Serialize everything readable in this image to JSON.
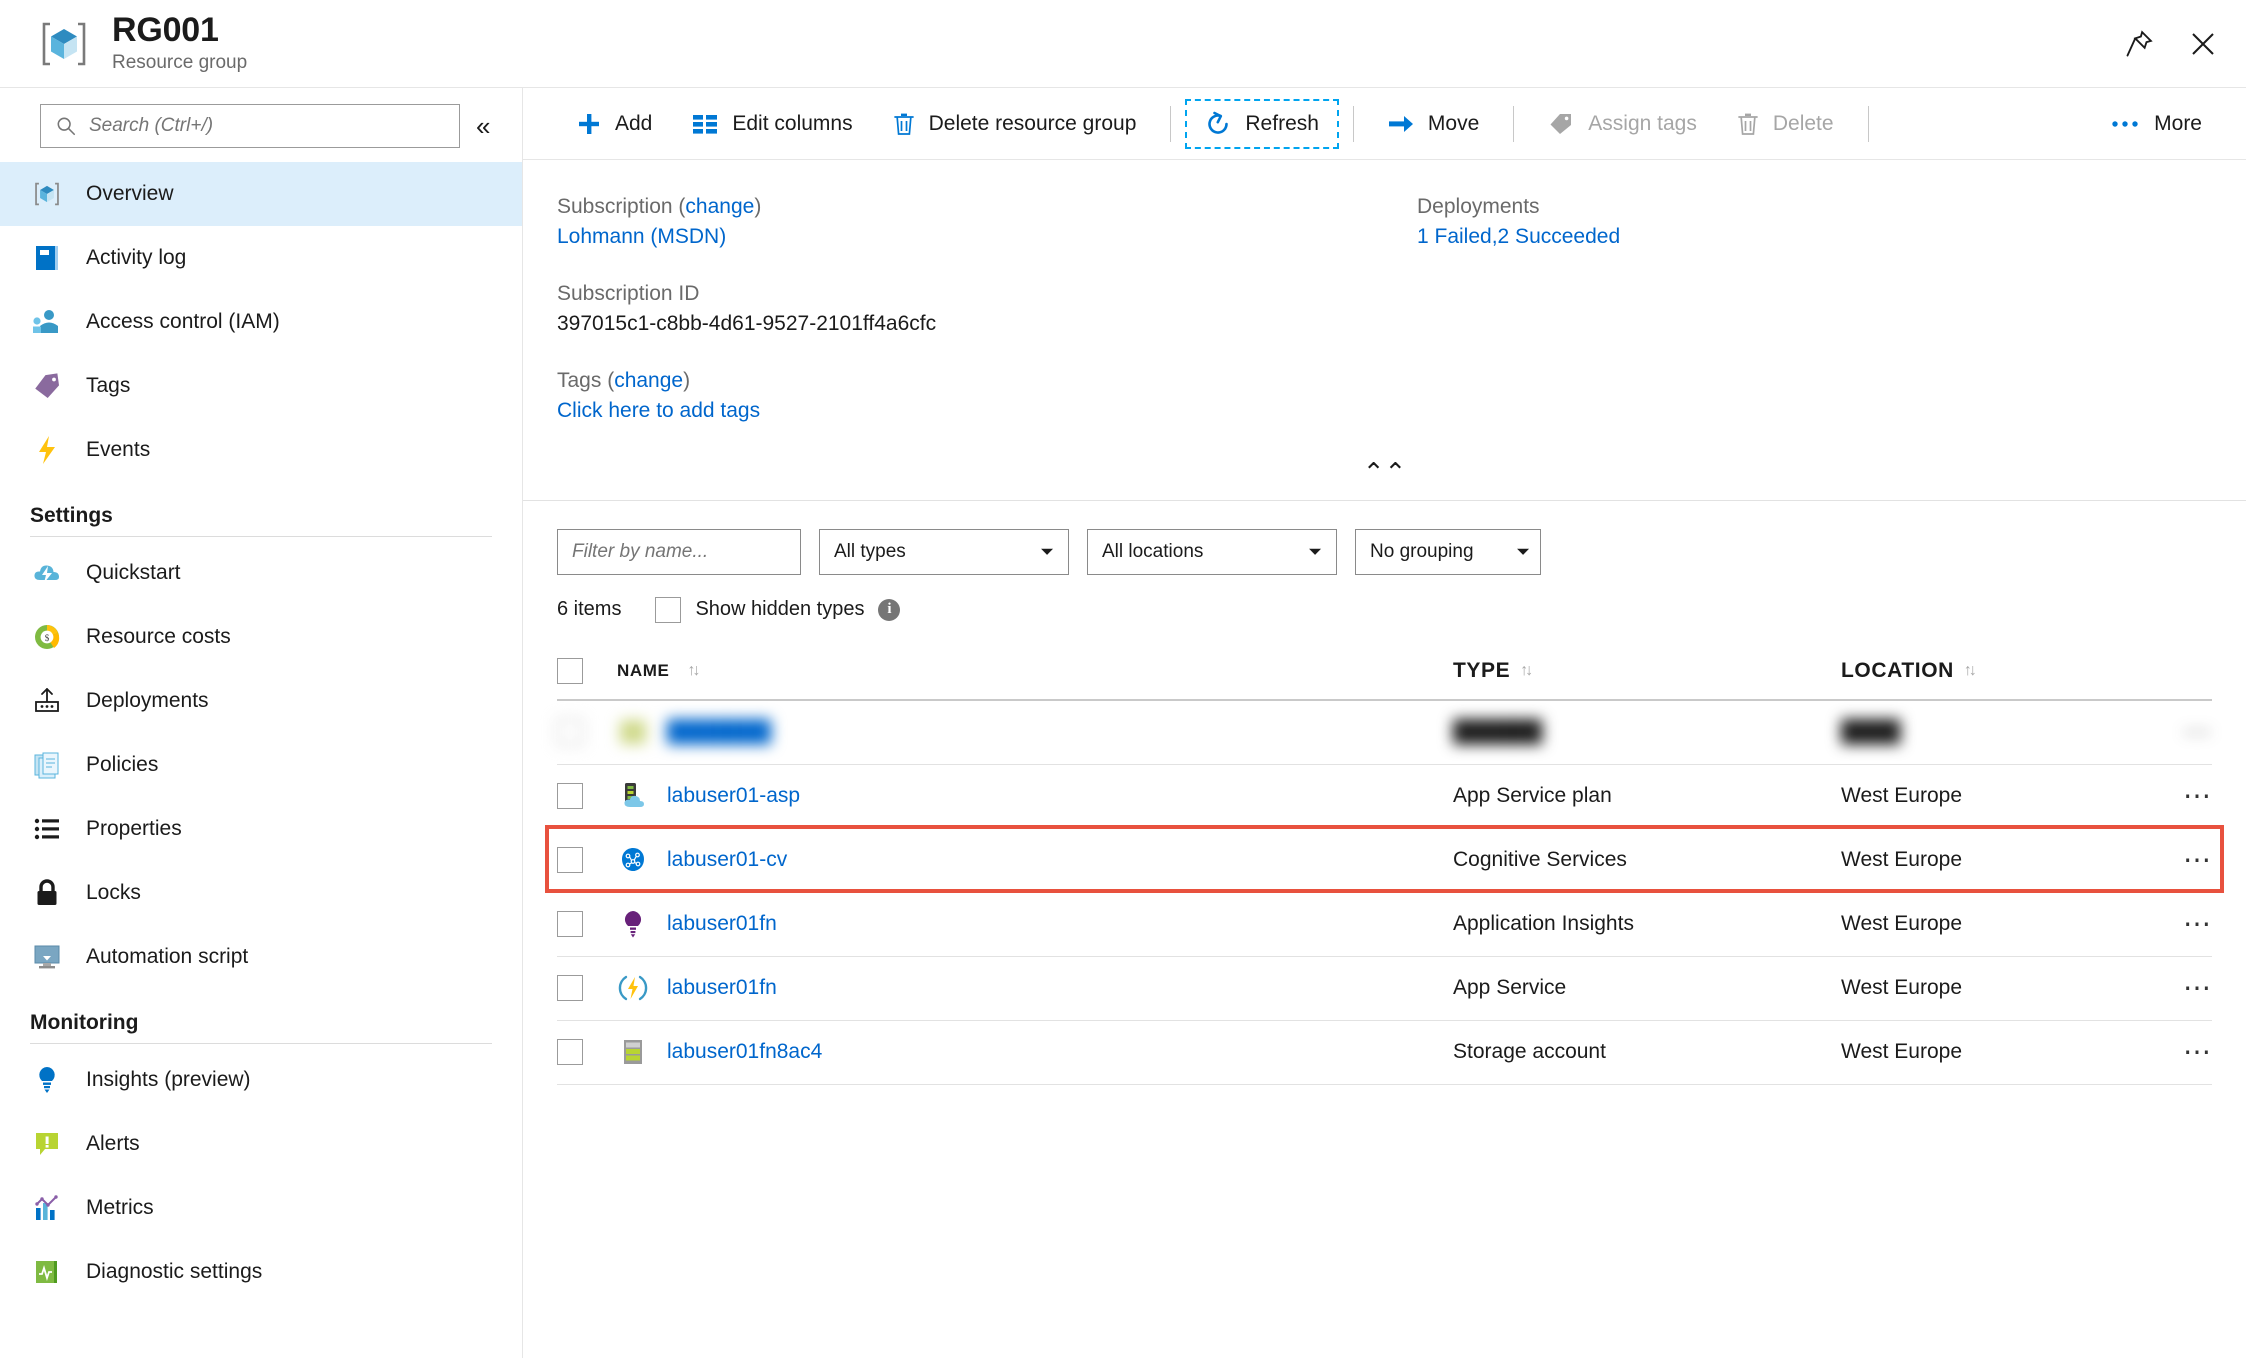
{
  "header": {
    "title": "RG001",
    "subtitle": "Resource group",
    "icon": "resource-group-icon",
    "pin_icon": "pin-icon",
    "close_icon": "close-icon"
  },
  "sidebar": {
    "search": {
      "placeholder": "Search (Ctrl+/)",
      "icon": "search-icon",
      "value": ""
    },
    "collapse_icon": "chevron-double-left-icon",
    "items": [
      {
        "label": "Overview",
        "icon": "cube-icon",
        "selected": true
      },
      {
        "label": "Activity log",
        "icon": "book-icon",
        "selected": false
      },
      {
        "label": "Access control (IAM)",
        "icon": "people-icon",
        "selected": false
      },
      {
        "label": "Tags",
        "icon": "tag-icon",
        "selected": false
      },
      {
        "label": "Events",
        "icon": "lightning-icon",
        "selected": false
      }
    ],
    "groups": [
      {
        "title": "Settings",
        "items": [
          {
            "label": "Quickstart",
            "icon": "cloud-lightning-icon"
          },
          {
            "label": "Resource costs",
            "icon": "donut-dollar-icon"
          },
          {
            "label": "Deployments",
            "icon": "deployment-upload-icon"
          },
          {
            "label": "Policies",
            "icon": "documents-icon"
          },
          {
            "label": "Properties",
            "icon": "list-icon"
          },
          {
            "label": "Locks",
            "icon": "lock-icon"
          },
          {
            "label": "Automation script",
            "icon": "monitor-download-icon"
          }
        ]
      },
      {
        "title": "Monitoring",
        "items": [
          {
            "label": "Insights (preview)",
            "icon": "lightbulb-icon"
          },
          {
            "label": "Alerts",
            "icon": "alert-icon"
          },
          {
            "label": "Metrics",
            "icon": "bar-chart-icon"
          },
          {
            "label": "Diagnostic settings",
            "icon": "diagnostics-icon"
          }
        ]
      }
    ]
  },
  "toolbar": {
    "add": {
      "label": "Add",
      "icon": "plus-icon",
      "disabled": false
    },
    "edit_columns": {
      "label": "Edit columns",
      "icon": "columns-icon",
      "disabled": false
    },
    "delete_resource_group": {
      "label": "Delete resource group",
      "icon": "trash-icon",
      "disabled": false
    },
    "refresh": {
      "label": "Refresh",
      "icon": "refresh-icon",
      "disabled": false,
      "focused": true
    },
    "move": {
      "label": "Move",
      "icon": "arrow-right-icon",
      "disabled": false
    },
    "assign_tags": {
      "label": "Assign tags",
      "icon": "tag-icon",
      "disabled": true
    },
    "delete": {
      "label": "Delete",
      "icon": "trash-icon",
      "disabled": true
    },
    "more": {
      "label": "More",
      "icon": "ellipsis-icon",
      "disabled": false
    }
  },
  "essentials": {
    "subscription_label": "Subscription",
    "subscription_change": "change",
    "subscription_value": "Lohmann (MSDN)",
    "subscription_id_label": "Subscription ID",
    "subscription_id_value": "397015c1-c8bb-4d61-9527-2101ff4a6cfc",
    "tags_label": "Tags",
    "tags_change": "change",
    "tags_add_link": "Click here to add tags",
    "deployments_label": "Deployments",
    "deployments_value": "1 Failed,2 Succeeded",
    "collapse_icon": "chevron-double-up-icon"
  },
  "filters": {
    "name_filter_placeholder": "Filter by name...",
    "name_filter_value": "",
    "type_filter": "All types",
    "location_filter": "All locations",
    "grouping_filter": "No grouping",
    "caret_icon": "chevron-down-icon"
  },
  "list_options": {
    "items_count": "6 items",
    "show_hidden_types": "Show hidden types",
    "show_hidden_checked": false,
    "info_icon": "info-icon"
  },
  "table": {
    "columns": [
      {
        "key": "name",
        "label": "NAME",
        "sort_icon": "sort-arrows-icon"
      },
      {
        "key": "type",
        "label": "TYPE",
        "sort_icon": "sort-arrows-icon"
      },
      {
        "key": "location",
        "label": "LOCATION",
        "sort_icon": "sort-arrows-icon"
      }
    ],
    "rows": [
      {
        "name": "",
        "type": "",
        "location": "",
        "icon": "blurred-icon",
        "blurred": true,
        "highlighted": false,
        "menu_icon": "ellipsis-icon"
      },
      {
        "name": "labuser01-asp",
        "type": "App Service plan",
        "location": "West Europe",
        "icon": "app-service-plan-icon",
        "blurred": false,
        "highlighted": false,
        "menu_icon": "ellipsis-icon"
      },
      {
        "name": "labuser01-cv",
        "type": "Cognitive Services",
        "location": "West Europe",
        "icon": "cognitive-services-icon",
        "blurred": false,
        "highlighted": true,
        "menu_icon": "ellipsis-icon"
      },
      {
        "name": "labuser01fn",
        "type": "Application Insights",
        "location": "West Europe",
        "icon": "application-insights-icon",
        "blurred": false,
        "highlighted": false,
        "menu_icon": "ellipsis-icon"
      },
      {
        "name": "labuser01fn",
        "type": "App Service",
        "location": "West Europe",
        "icon": "app-service-icon",
        "blurred": false,
        "highlighted": false,
        "menu_icon": "ellipsis-icon"
      },
      {
        "name": "labuser01fn8ac4",
        "type": "Storage account",
        "location": "West Europe",
        "icon": "storage-account-icon",
        "blurred": false,
        "highlighted": false,
        "menu_icon": "ellipsis-icon"
      }
    ]
  },
  "colors": {
    "accent_blue": "#0066cc",
    "toolbar_blue": "#0078d4",
    "selected_nav_bg": "#dceefb",
    "highlight_red": "#e8513e",
    "focus_outline": "#00a4ef"
  }
}
